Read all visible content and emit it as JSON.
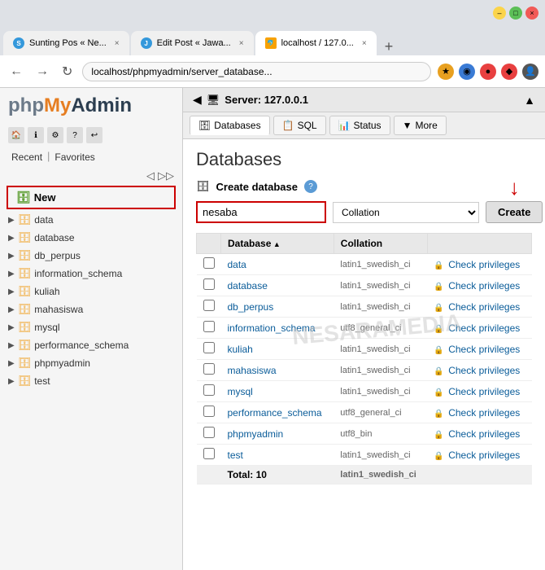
{
  "browser": {
    "tabs": [
      {
        "id": "tab1",
        "label": "Sunting Pos « Ne...",
        "favicon": "S",
        "active": false
      },
      {
        "id": "tab2",
        "label": "Edit Post « Jawa...",
        "favicon": "J",
        "active": false
      },
      {
        "id": "tab3",
        "label": "localhost / 127.0...",
        "favicon": "P",
        "active": true
      }
    ],
    "address": "localhost/phpmyadmin/server_database...",
    "title_bar_buttons": [
      "minimize",
      "maximize",
      "close"
    ]
  },
  "sidebar": {
    "logo_php": "php",
    "logo_my": "My",
    "logo_admin": "Admin",
    "tabs": [
      {
        "label": "Recent"
      },
      {
        "label": "Favorites"
      }
    ],
    "new_label": "New",
    "databases": [
      {
        "name": "data"
      },
      {
        "name": "database"
      },
      {
        "name": "db_perpus"
      },
      {
        "name": "information_schema"
      },
      {
        "name": "kuliah"
      },
      {
        "name": "mahasiswa"
      },
      {
        "name": "mysql"
      },
      {
        "name": "performance_schema"
      },
      {
        "name": "phpmyadmin"
      },
      {
        "name": "test"
      }
    ]
  },
  "content": {
    "server_title": "Server: 127.0.0.1",
    "nav_buttons": [
      {
        "id": "databases",
        "label": "Databases",
        "active": true
      },
      {
        "id": "sql",
        "label": "SQL",
        "active": false
      },
      {
        "id": "status",
        "label": "Status",
        "active": false
      },
      {
        "id": "more",
        "label": "More",
        "active": false
      }
    ],
    "page_title": "Databases",
    "create_db_label": "Create database",
    "db_name_input_value": "nesaba",
    "db_name_placeholder": "",
    "collation_placeholder": "Collation",
    "create_button": "Create",
    "table": {
      "headers": [
        "",
        "Database",
        "Collation",
        ""
      ],
      "rows": [
        {
          "name": "data",
          "collation": "latin1_swedish_ci",
          "check": "Check privileges"
        },
        {
          "name": "database",
          "collation": "latin1_swedish_ci",
          "check": "Check privileges"
        },
        {
          "name": "db_perpus",
          "collation": "latin1_swedish_ci",
          "check": "Check privileges"
        },
        {
          "name": "information_schema",
          "collation": "utf8_general_ci",
          "check": "Check privileges"
        },
        {
          "name": "kuliah",
          "collation": "latin1_swedish_ci",
          "check": "Check privileges"
        },
        {
          "name": "mahasiswa",
          "collation": "latin1_swedish_ci",
          "check": "Check privileges"
        },
        {
          "name": "mysql",
          "collation": "latin1_swedish_ci",
          "check": "Check privileges"
        },
        {
          "name": "performance_schema",
          "collation": "utf8_general_ci",
          "check": "Check privileges"
        },
        {
          "name": "phpmyadmin",
          "collation": "utf8_bin",
          "check": "Check privileges"
        },
        {
          "name": "test",
          "collation": "latin1_swedish_ci",
          "check": "Check privileges"
        }
      ],
      "total_label": "Total: 10",
      "total_collation": "latin1_swedish_ci"
    },
    "watermark": "NESARAMEDIA"
  }
}
